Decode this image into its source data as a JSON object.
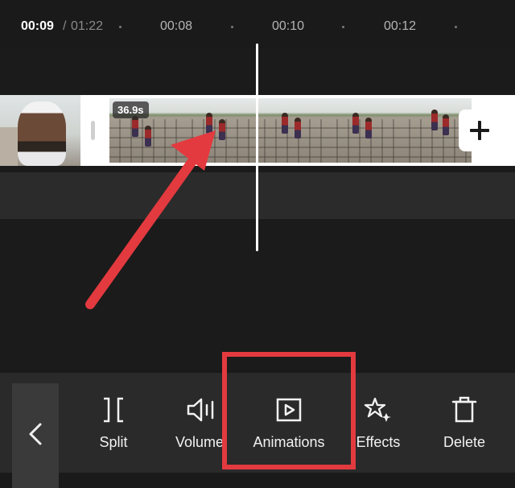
{
  "timeline": {
    "current_time": "00:09",
    "separator": "/",
    "total_time": "01:22",
    "ticks": [
      "00:08",
      "00:10",
      "00:12"
    ]
  },
  "clip": {
    "duration": "36.9s"
  },
  "toolbar": {
    "items": [
      {
        "label": "Split",
        "icon": "split-icon"
      },
      {
        "label": "Volume",
        "icon": "volume-icon"
      },
      {
        "label": "Animations",
        "icon": "animations-icon"
      },
      {
        "label": "Effects",
        "icon": "effects-icon"
      },
      {
        "label": "Delete",
        "icon": "delete-icon"
      }
    ]
  },
  "colors": {
    "background": "#1a1a1a",
    "toolbar": "#2a2a2a",
    "annotation": "#e33a3f",
    "text": "#ffffff"
  }
}
